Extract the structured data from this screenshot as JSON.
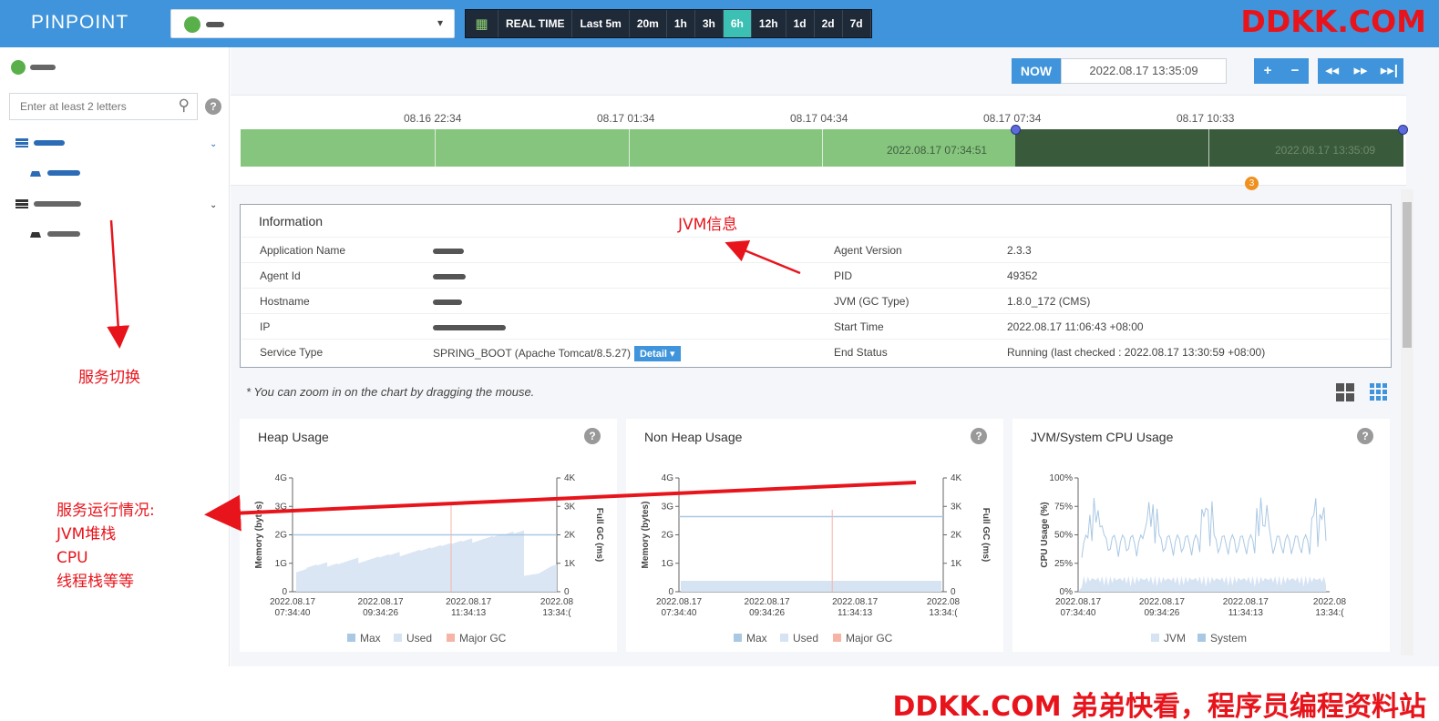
{
  "topbar": {
    "logo": "PINPOINT",
    "time_range_buttons": [
      "REAL TIME",
      "Last 5m",
      "20m",
      "1h",
      "3h",
      "6h",
      "12h",
      "1d",
      "2d",
      "7d"
    ],
    "active_range": "6h",
    "brand_watermark": "DDKK.COM"
  },
  "sidebar": {
    "search_placeholder": "Enter at least 2 letters"
  },
  "controls": {
    "now_label": "NOW",
    "current_time": "2022.08.17 13:35:09",
    "zoom_in": "+",
    "zoom_out": "−"
  },
  "timeline": {
    "ticks": [
      "08.16 22:34",
      "08.17 01:34",
      "08.17 04:34",
      "08.17 07:34",
      "08.17 10:33"
    ],
    "selection_start": "2022.08.17 07:34:51",
    "selection_end": "2022.08.17 13:35:09",
    "event_count": "3"
  },
  "info": {
    "title": "Information",
    "rows": [
      {
        "k1": "Application Name",
        "v1": "",
        "k2": "Agent Version",
        "v2": "2.3.3"
      },
      {
        "k1": "Agent Id",
        "v1": "",
        "k2": "PID",
        "v2": "49352"
      },
      {
        "k1": "Hostname",
        "v1": "",
        "k2": "JVM (GC Type)",
        "v2": "1.8.0_172 (CMS)"
      },
      {
        "k1": "IP",
        "v1": "",
        "k2": "Start Time",
        "v2": "2022.08.17 11:06:43 +08:00"
      },
      {
        "k1": "Service Type",
        "v1": "SPRING_BOOT (Apache Tomcat/8.5.27)",
        "k2": "End Status",
        "v2": "Running (last checked : 2022.08.17 13:30:59 +08:00)"
      }
    ],
    "detail_button": "Detail ▾"
  },
  "zoom_note": "* You can zoom in on the chart by dragging the mouse.",
  "charts": {
    "heap": {
      "title": "Heap Usage",
      "y_left_label": "Memory (bytes)",
      "y_right_label": "Full GC (ms)",
      "y_left_ticks": [
        "4G",
        "3G",
        "2G",
        "1G",
        "0"
      ],
      "y_right_ticks": [
        "4K",
        "3K",
        "2K",
        "1K",
        "0"
      ],
      "x_ticks": [
        [
          "2022.08.17",
          "07:34:40"
        ],
        [
          "2022.08.17",
          "09:34:26"
        ],
        [
          "2022.08.17",
          "11:34:13"
        ],
        [
          "2022.08",
          "13:34:("
        ]
      ],
      "legend": [
        "Max",
        "Used",
        "Major GC"
      ]
    },
    "nonheap": {
      "title": "Non Heap Usage",
      "y_left_label": "Memory (bytes)",
      "y_right_label": "Full GC (ms)",
      "y_left_ticks": [
        "4G",
        "3G",
        "2G",
        "1G",
        "0"
      ],
      "y_right_ticks": [
        "4K",
        "3K",
        "2K",
        "1K",
        "0"
      ],
      "x_ticks": [
        [
          "2022.08.17",
          "07:34:40"
        ],
        [
          "2022.08.17",
          "09:34:26"
        ],
        [
          "2022.08.17",
          "11:34:13"
        ],
        [
          "2022.08",
          "13:34:("
        ]
      ],
      "legend": [
        "Max",
        "Used",
        "Major GC"
      ]
    },
    "cpu": {
      "title": "JVM/System CPU Usage",
      "y_left_label": "CPU Usage (%)",
      "y_left_ticks": [
        "100%",
        "75%",
        "50%",
        "25%",
        "0%"
      ],
      "x_ticks": [
        [
          "2022.08.17",
          "07:34:40"
        ],
        [
          "2022.08.17",
          "09:34:26"
        ],
        [
          "2022.08.17",
          "11:34:13"
        ],
        [
          "2022.08",
          "13:34:("
        ]
      ],
      "legend": [
        "JVM",
        "System"
      ]
    }
  },
  "annotations": {
    "jvm_info": "JVM信息",
    "service_switch": "服务切换",
    "service_status_lines": [
      "服务运行情况:",
      "JVM堆栈",
      "CPU",
      "线程栈等等"
    ],
    "bottom_watermark": "DDKK.COM 弟弟快看，程序员编程资料站"
  },
  "colors": {
    "topbar": "#3f94db",
    "timeline_green": "#86c57e",
    "timeline_selected": "#3a5a3c",
    "annotation_red": "#e8141c",
    "max_series": "#a9c8e4",
    "used_series": "#d6e3f3",
    "gc_series": "#f5b4a6"
  }
}
